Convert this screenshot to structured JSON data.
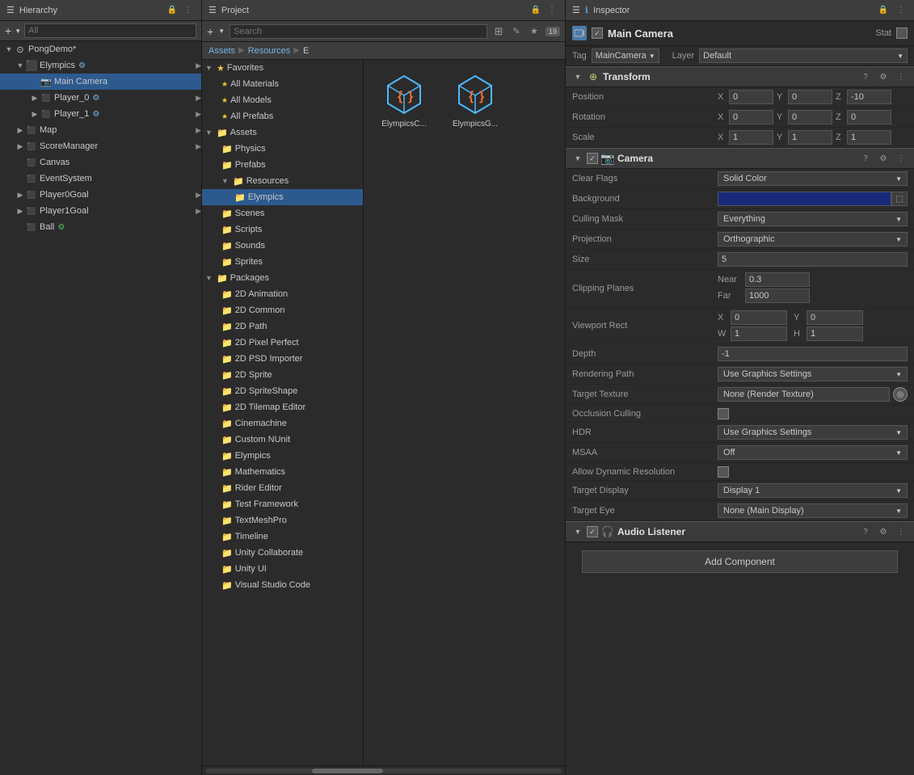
{
  "hierarchy": {
    "title": "Hierarchy",
    "search_placeholder": "All",
    "items": [
      {
        "id": "pongdemo",
        "label": "PongDemo*",
        "depth": 0,
        "type": "scene",
        "has_arrow": true,
        "expanded": true
      },
      {
        "id": "elympics",
        "label": "Elympics",
        "depth": 1,
        "type": "gameobj",
        "has_arrow": true,
        "expanded": true,
        "selected": false,
        "has_badge": true
      },
      {
        "id": "main-camera",
        "label": "Main Camera",
        "depth": 2,
        "type": "camera",
        "has_arrow": false,
        "expanded": false,
        "selected": true
      },
      {
        "id": "player0",
        "label": "Player_0",
        "depth": 2,
        "type": "gameobj",
        "has_arrow": true,
        "expanded": false,
        "has_badge": true
      },
      {
        "id": "player1",
        "label": "Player_1",
        "depth": 2,
        "type": "gameobj",
        "has_arrow": true,
        "expanded": false,
        "has_badge": true
      },
      {
        "id": "map",
        "label": "Map",
        "depth": 1,
        "type": "gameobj",
        "has_arrow": true,
        "expanded": false
      },
      {
        "id": "scoremanager",
        "label": "ScoreManager",
        "depth": 1,
        "type": "gameobj",
        "has_arrow": true,
        "expanded": false
      },
      {
        "id": "canvas",
        "label": "Canvas",
        "depth": 1,
        "type": "gameobj",
        "has_arrow": false,
        "expanded": false
      },
      {
        "id": "eventsystem",
        "label": "EventSystem",
        "depth": 1,
        "type": "gameobj",
        "has_arrow": false,
        "expanded": false
      },
      {
        "id": "player0goal",
        "label": "Player0Goal",
        "depth": 1,
        "type": "gameobj",
        "has_arrow": true,
        "expanded": false
      },
      {
        "id": "player1goal",
        "label": "Player1Goal",
        "depth": 1,
        "type": "gameobj",
        "has_arrow": true,
        "expanded": false
      },
      {
        "id": "ball",
        "label": "Ball",
        "depth": 1,
        "type": "gameobj",
        "has_arrow": false,
        "expanded": false,
        "has_badge2": true
      }
    ]
  },
  "project": {
    "title": "Project",
    "badge_count": "19",
    "breadcrumbs": [
      "Assets",
      "Resources",
      "E"
    ],
    "favorites": [
      {
        "label": "All Materials"
      },
      {
        "label": "All Models"
      },
      {
        "label": "All Prefabs"
      }
    ],
    "tree": [
      {
        "label": "Assets",
        "depth": 0,
        "expanded": true
      },
      {
        "label": "Physics",
        "depth": 1
      },
      {
        "label": "Prefabs",
        "depth": 1
      },
      {
        "label": "Resources",
        "depth": 1,
        "expanded": true
      },
      {
        "label": "Elympics",
        "depth": 2,
        "selected": true
      },
      {
        "label": "Scenes",
        "depth": 1
      },
      {
        "label": "Scripts",
        "depth": 1
      },
      {
        "label": "Sounds",
        "depth": 1
      },
      {
        "label": "Sprites",
        "depth": 1
      },
      {
        "label": "Packages",
        "depth": 0,
        "expanded": true
      },
      {
        "label": "2D Animation",
        "depth": 1
      },
      {
        "label": "2D Common",
        "depth": 1
      },
      {
        "label": "2D Path",
        "depth": 1
      },
      {
        "label": "2D Pixel Perfect",
        "depth": 1
      },
      {
        "label": "2D PSD Importer",
        "depth": 1
      },
      {
        "label": "2D Sprite",
        "depth": 1
      },
      {
        "label": "2D SpriteShape",
        "depth": 1
      },
      {
        "label": "2D Tilemap Editor",
        "depth": 1
      },
      {
        "label": "Cinemachine",
        "depth": 1
      },
      {
        "label": "Custom NUnit",
        "depth": 1
      },
      {
        "label": "Elympics",
        "depth": 1
      },
      {
        "label": "Mathematics",
        "depth": 1
      },
      {
        "label": "Rider Editor",
        "depth": 1
      },
      {
        "label": "Test Framework",
        "depth": 1
      },
      {
        "label": "TextMeshPro",
        "depth": 1
      },
      {
        "label": "Timeline",
        "depth": 1
      },
      {
        "label": "Unity Collaborate",
        "depth": 1
      },
      {
        "label": "Unity UI",
        "depth": 1
      },
      {
        "label": "Visual Studio Code",
        "depth": 1
      }
    ],
    "assets": [
      {
        "label": "ElympicsC..."
      },
      {
        "label": "ElympicsG..."
      }
    ]
  },
  "inspector": {
    "title": "Inspector",
    "object_name": "Main Camera",
    "tag_label": "Tag",
    "tag_value": "MainCamera",
    "layer_label": "Layer",
    "layer_value": "Default",
    "static_label": "Static",
    "transform": {
      "title": "Transform",
      "position": {
        "label": "Position",
        "x": "0",
        "y": "0",
        "z": "-10"
      },
      "rotation": {
        "label": "Rotation",
        "x": "0",
        "y": "0",
        "z": "0"
      },
      "scale": {
        "label": "Scale",
        "x": "1",
        "y": "1",
        "z": "1"
      }
    },
    "camera": {
      "title": "Camera",
      "clear_flags": {
        "label": "Clear Flags",
        "value": "Solid Color"
      },
      "background": {
        "label": "Background"
      },
      "culling_mask": {
        "label": "Culling Mask",
        "value": "Everything"
      },
      "projection": {
        "label": "Projection",
        "value": "Orthographic"
      },
      "size": {
        "label": "Size",
        "value": "5"
      },
      "clipping_planes": {
        "label": "Clipping Planes",
        "near_label": "Near",
        "near_value": "0.3",
        "far_label": "Far",
        "far_value": "1000"
      },
      "viewport_rect": {
        "label": "Viewport Rect",
        "x": "0",
        "y": "0",
        "w": "1",
        "h": "1"
      },
      "depth": {
        "label": "Depth",
        "value": "-1"
      },
      "rendering_path": {
        "label": "Rendering Path",
        "value": "Use Graphics Settings"
      },
      "target_texture": {
        "label": "Target Texture",
        "value": "None (Render Texture)"
      },
      "occlusion_culling": {
        "label": "Occlusion Culling"
      },
      "hdr": {
        "label": "HDR",
        "value": "Use Graphics Settings"
      },
      "msaa": {
        "label": "MSAA",
        "value": "Off"
      },
      "allow_dynamic_resolution": {
        "label": "Allow Dynamic Resolution"
      },
      "target_display": {
        "label": "Target Display",
        "value": "Display 1"
      },
      "target_eye": {
        "label": "Target Eye",
        "value": "None (Main Display)"
      }
    },
    "audio_listener": {
      "title": "Audio Listener"
    },
    "add_component_label": "Add Component"
  }
}
